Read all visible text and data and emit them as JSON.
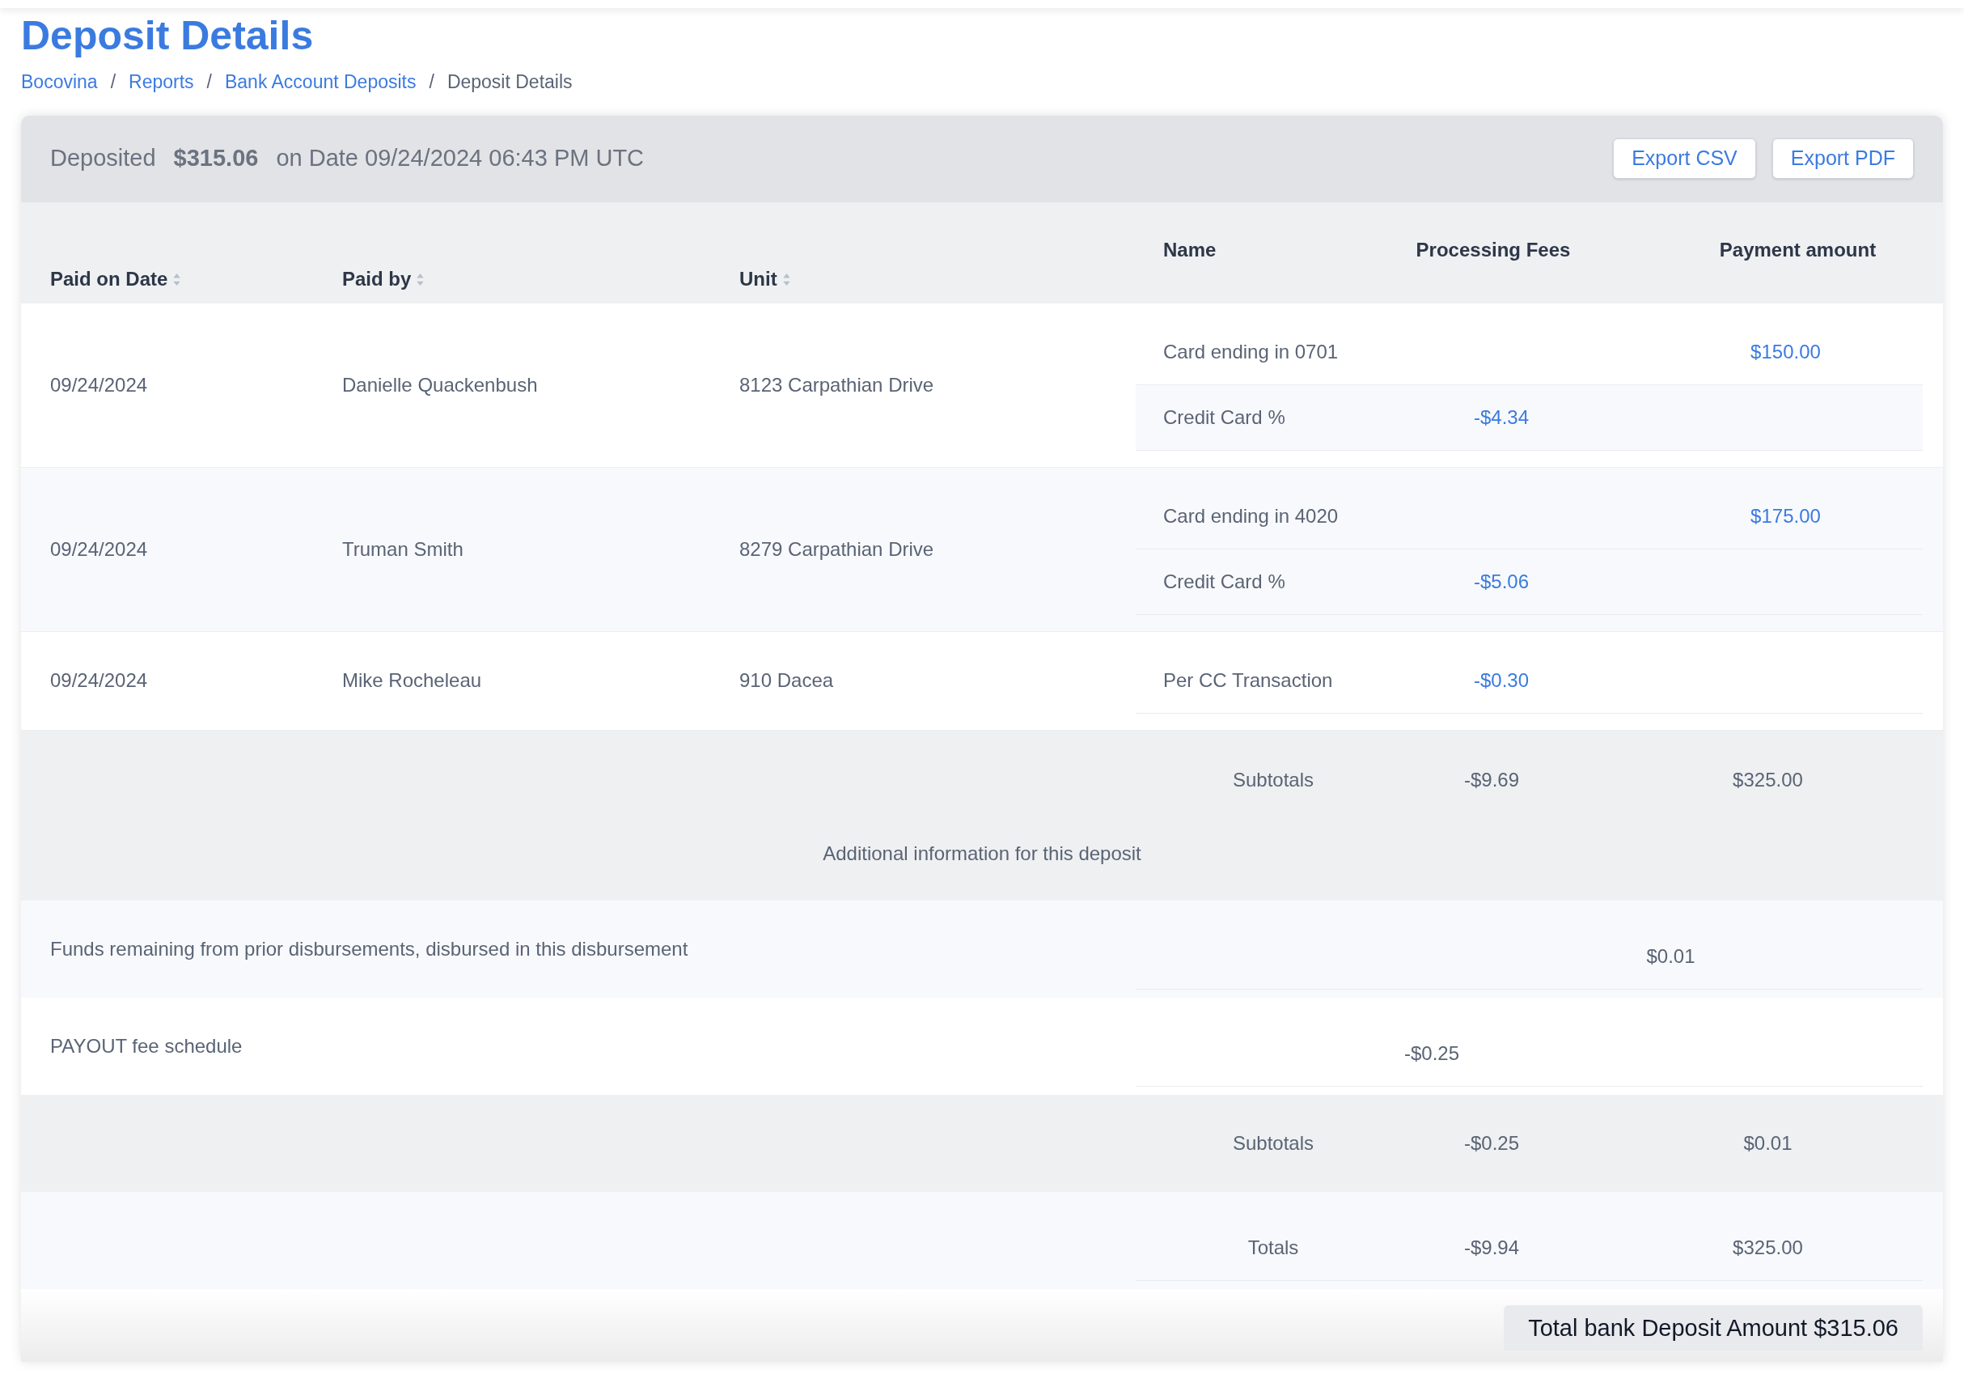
{
  "title": "Deposit Details",
  "breadcrumb_separator": "/",
  "breadcrumb": [
    {
      "label": "Bocovina",
      "link": true
    },
    {
      "label": "Reports",
      "link": true
    },
    {
      "label": "Bank Account Deposits",
      "link": true
    },
    {
      "label": "Deposit Details",
      "link": false
    }
  ],
  "summary": {
    "label": "Deposited",
    "amount": "$315.06",
    "date_text": "on Date 09/24/2024 06:43 PM UTC"
  },
  "buttons": [
    "Export CSV",
    "Export PDF"
  ],
  "columns": [
    {
      "label": "Paid on Date",
      "sortable": true
    },
    {
      "label": "Paid by",
      "sortable": true
    },
    {
      "label": "Unit",
      "sortable": true
    },
    {
      "label": "Name",
      "sortable": false
    },
    {
      "label": "Processing Fees",
      "sortable": false
    },
    {
      "label": "Payment amount",
      "sortable": false
    }
  ],
  "payments": [
    {
      "date": "09/24/2024",
      "paid_by": "Danielle Quackenbush",
      "unit": "8123 Carpathian Drive",
      "lines": [
        {
          "name": "Card ending in 0701",
          "amount": "$150.00"
        },
        {
          "name": "Credit Card %",
          "fee": "-$4.34"
        }
      ]
    },
    {
      "date": "09/24/2024",
      "paid_by": "Truman Smith",
      "unit": "8279 Carpathian Drive",
      "lines": [
        {
          "name": "Card ending in 4020",
          "amount": "$175.00"
        },
        {
          "name": "Credit Card %",
          "fee": "-$5.06"
        }
      ]
    },
    {
      "date": "09/24/2024",
      "paid_by": "Mike Rocheleau",
      "unit": "910 Dacea",
      "lines": [
        {
          "name": "Per CC Transaction",
          "fee": "-$0.30"
        }
      ]
    }
  ],
  "subtotals": {
    "label": "Subtotals",
    "fees": "-$9.69",
    "amount": "$325.00"
  },
  "additional": {
    "heading": "Additional information for this deposit",
    "items": [
      {
        "label": "Funds remaining from prior disbursements, disbursed in this disbursement",
        "amount": "$0.01"
      },
      {
        "label": "PAYOUT fee schedule",
        "fee": "-$0.25"
      }
    ]
  },
  "additional_subtotals": {
    "label": "Subtotals",
    "fees": "-$0.25",
    "amount": "$0.01"
  },
  "totals": {
    "label": "Totals",
    "fees": "-$9.94",
    "amount": "$325.00"
  },
  "total_deposit": "Total bank Deposit Amount $315.06"
}
